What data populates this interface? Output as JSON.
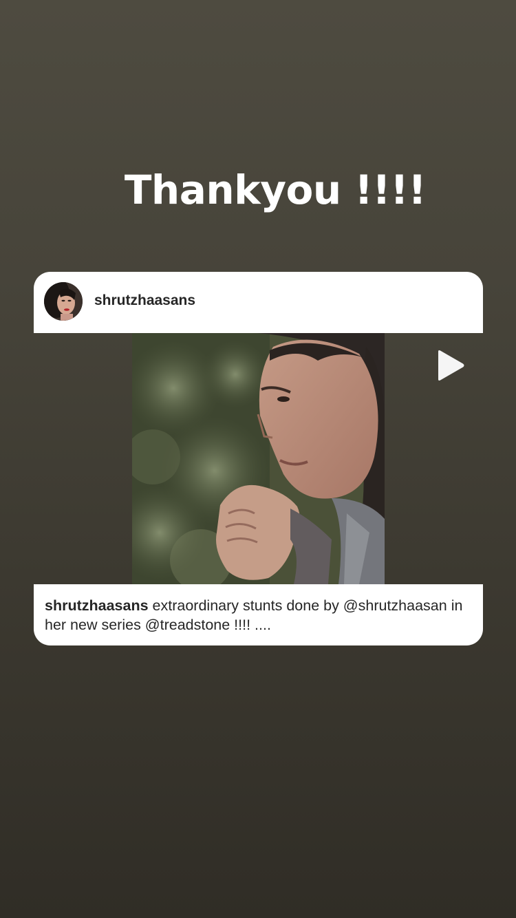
{
  "story": {
    "text": "Thankyou !!!!"
  },
  "post": {
    "username": "shrutzhaasans",
    "caption": {
      "user": "shrutzhaasans",
      "body": "extraordinary stunts done by @shrutzhaasan in her new series @treadstone !!!! ...."
    },
    "media_type": "video"
  },
  "icons": {
    "play": "play-icon",
    "avatar": "avatar-photo"
  }
}
